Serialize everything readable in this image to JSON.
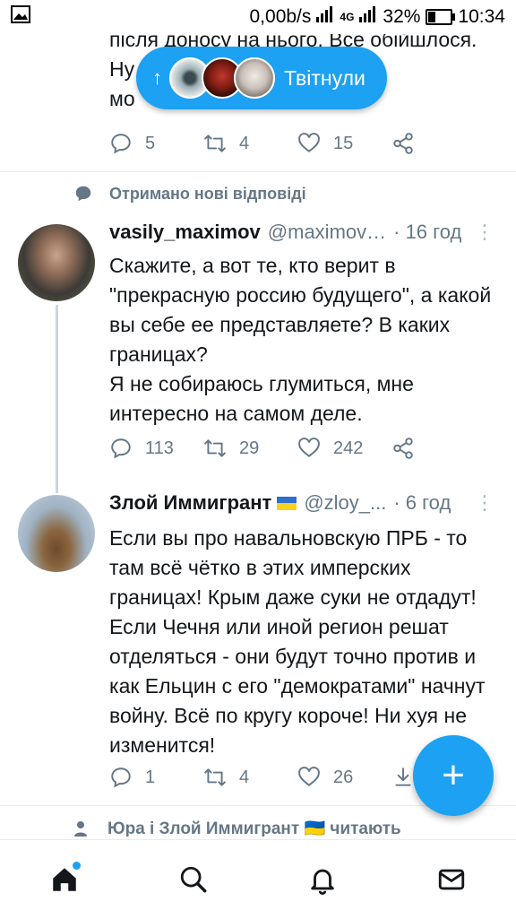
{
  "status_bar": {
    "speed": "0,00b/s",
    "network": "4G",
    "battery": "32%",
    "time": "10:34"
  },
  "prev_tweet": {
    "text_lines": [
      "після доносу на нього. Все обійшлося.",
      "Ну",
      "мо"
    ],
    "replies": "5",
    "retweets": "4",
    "likes": "15"
  },
  "pill": {
    "label": "Твітнули"
  },
  "context": {
    "text": "Отримано нові відповіді"
  },
  "tweet1": {
    "name": "vasily_maximov",
    "handle": "@maximov…",
    "time": "· 16 год",
    "text": "Скажите, а вот те, кто верит в \"прекрасную россию будущего\", а какой вы себе ее представляете? В каких границах?\nЯ не собираюсь глумиться, мне интересно на самом деле.",
    "replies": "113",
    "retweets": "29",
    "likes": "242"
  },
  "tweet2": {
    "name": "Злой Иммигрант",
    "handle": "@zloy_...",
    "time": "· 6 год",
    "text": "Если вы про навальновскую ПРБ - то там всё чётко в этих имперских границах! Крым даже суки не отдадут! Если Чечня или иной регион решат отделяться - они будут точно против и как Ельцин с его \"демократами\" начнут войну. Всё по кругу короче! Ни хуя не изменится!",
    "replies": "1",
    "retweets": "4",
    "likes": "26"
  },
  "partial_context": {
    "text": "Юра і Злой Иммигрант 🇺🇦 читають"
  },
  "fab": {
    "label": "+"
  },
  "colors": {
    "accent": "#1da1f2",
    "muted": "#657786",
    "text": "#14171a"
  },
  "icons": [
    "reply-icon",
    "retweet-icon",
    "like-icon",
    "share-icon",
    "home-icon",
    "search-icon",
    "bell-icon",
    "mail-icon"
  ]
}
